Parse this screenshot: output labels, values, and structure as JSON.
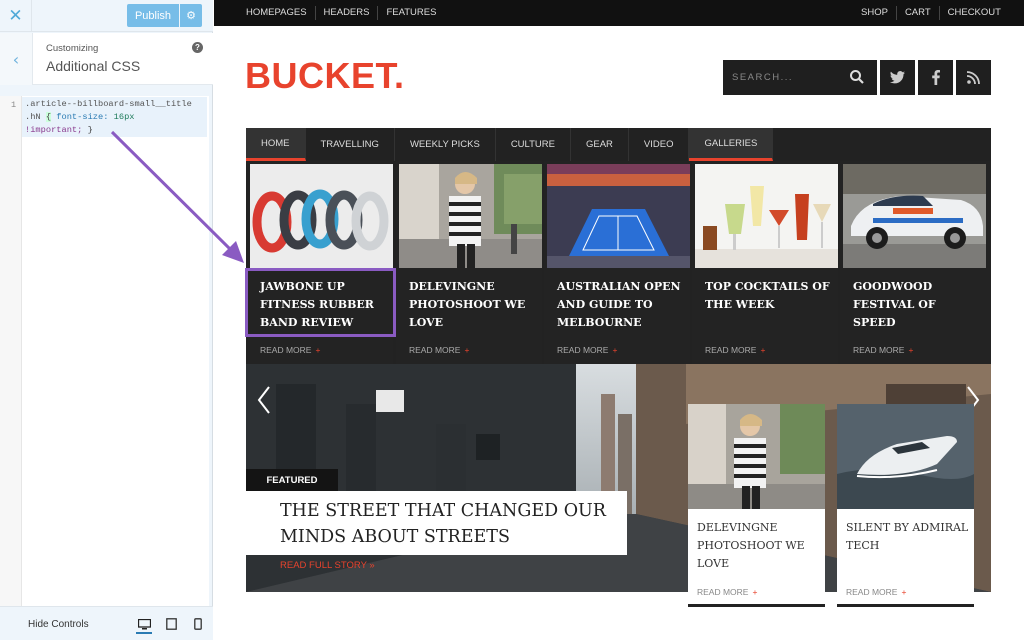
{
  "customizer": {
    "close": "✕",
    "publish_label": "Publish",
    "gear": "⚙",
    "back": "‹",
    "breadcrumb": "Customizing",
    "section_title": "Additional CSS",
    "help": "?",
    "line_number": "1",
    "code_line1": ".article--billboard-small__title",
    "code_sel2": ".hN",
    "code_brace_open": "{",
    "code_prop": "font-size:",
    "code_val": "16px",
    "code_imp": "!important;",
    "code_brace_close": "}",
    "hide_controls": "Hide Controls"
  },
  "site": {
    "top_left_links": [
      "HOMEPAGES",
      "HEADERS",
      "FEATURES"
    ],
    "top_right_links": [
      "SHOP",
      "CART",
      "CHECKOUT"
    ],
    "logo": "BUCKET.",
    "search_placeholder": "SEARCH...",
    "nav": [
      "HOME",
      "TRAVELLING",
      "WEEKLY PICKS",
      "CULTURE",
      "GEAR",
      "VIDEO",
      "GALLERIES"
    ],
    "cards": [
      {
        "title": "JAWBONE UP FITNESS RUBBER BAND REVIEW",
        "read_more": "READ MORE",
        "plus": "+"
      },
      {
        "title": "DELEVINGNE PHOTOSHOOT WE LOVE",
        "read_more": "READ MORE",
        "plus": "+"
      },
      {
        "title": "AUSTRALIAN OPEN AND GUIDE TO MELBOURNE",
        "read_more": "READ MORE",
        "plus": "+"
      },
      {
        "title": "TOP COCKTAILS OF THE WEEK",
        "read_more": "READ MORE",
        "plus": "+"
      },
      {
        "title": "GOODWOOD FESTIVAL OF SPEED",
        "read_more": "READ MORE",
        "plus": "+"
      }
    ],
    "featured_badge": "FEATURED",
    "featured_title": "THE STREET THAT CHANGED OUR MINDS ABOUT STREETS",
    "read_full": "READ FULL STORY »",
    "mini_cards": [
      {
        "title": "DELEVINGNE PHOTOSHOOT WE LOVE",
        "read_more": "READ MORE",
        "plus": "+"
      },
      {
        "title": "SILENT BY ADMIRAL TECH",
        "read_more": "READ MORE",
        "plus": "+"
      }
    ],
    "accent": "#e8432d",
    "highlight_color": "#8a5bc2"
  }
}
